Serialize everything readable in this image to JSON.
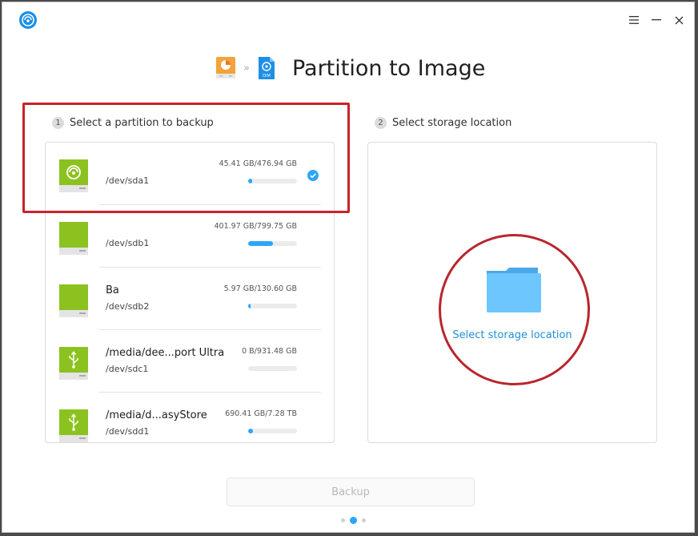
{
  "window": {
    "app_icon": "deepin-clone-logo-icon",
    "menu_icon": "hamburger-menu-icon",
    "minimize_icon": "minimize-icon",
    "close_icon": "close-icon"
  },
  "header": {
    "title": "Partition to Image",
    "source_icon": "partition-icon",
    "target_icon": "dim-image-icon",
    "target_icon_text": "DIM",
    "separator": "»"
  },
  "steps": {
    "step1": {
      "number": "1",
      "label": "Select a partition to backup"
    },
    "step2": {
      "number": "2",
      "label": "Select storage location"
    }
  },
  "partitions": [
    {
      "name": "",
      "device": "/dev/sda1",
      "size": "45.41 GB/476.94 GB",
      "usage_fraction": 0.09,
      "icon": "deepin-drive-icon",
      "selected": true
    },
    {
      "name": "",
      "device": "/dev/sdb1",
      "size": "401.97 GB/799.75 GB",
      "usage_fraction": 0.5,
      "icon": "hard-drive-icon",
      "selected": false
    },
    {
      "name": "Ba",
      "device": "/dev/sdb2",
      "size": "5.97 GB/130.60 GB",
      "usage_fraction": 0.046,
      "icon": "hard-drive-icon",
      "selected": false
    },
    {
      "name": "/media/dee...port Ultra",
      "device": "/dev/sdc1",
      "size": "0 B/931.48 GB",
      "usage_fraction": 0.0,
      "icon": "usb-drive-icon",
      "selected": false
    },
    {
      "name": "/media/d...asyStore",
      "device": "/dev/sdd1",
      "size": "690.41 GB/7.28 TB",
      "usage_fraction": 0.093,
      "icon": "usb-drive-icon",
      "selected": false
    }
  ],
  "storage": {
    "label": "Select storage location",
    "icon": "folder-icon"
  },
  "footer": {
    "backup_label": "Backup",
    "page_indicator": {
      "total": 3,
      "active": 2
    }
  },
  "colors": {
    "accent": "#2ca7f8",
    "link": "#1f8ed8",
    "drive_green": "#8cc21f",
    "highlight_red": "#c9232b",
    "folder_blue": "#6ec6ff"
  }
}
